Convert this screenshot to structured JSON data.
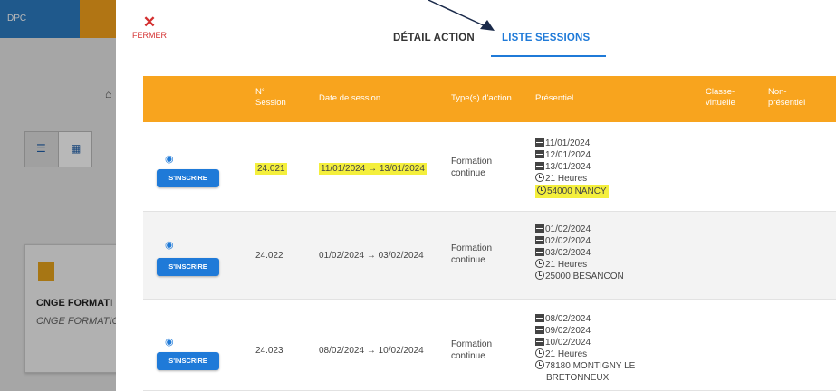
{
  "background": {
    "topbar_label": "DPC",
    "card_title": "CNGE FORMATI",
    "card_subtitle": "CNGE FORMATIO"
  },
  "modal": {
    "close_label": "FERMER",
    "tabs": [
      {
        "label": "DÉTAIL ACTION",
        "active": false
      },
      {
        "label": "LISTE SESSIONS",
        "active": true
      }
    ]
  },
  "table": {
    "headers": {
      "num": [
        "N°",
        "Session"
      ],
      "date": "Date de session",
      "type": "Type(s) d'action",
      "presentiel": "Présentiel",
      "classe": [
        "Classe-",
        "virtuelle"
      ],
      "non": [
        "Non-",
        "présentiel"
      ]
    },
    "button_label": "S'INSCRIRE",
    "rows": [
      {
        "num": "24.021",
        "dates": "11/01/2024 → 13/01/2024",
        "type": [
          "Formation",
          "continue"
        ],
        "presentiel_dates": [
          "11/01/2024",
          "12/01/2024",
          "13/01/2024"
        ],
        "hours": "21 Heures",
        "location": [
          "54000 NANCY"
        ],
        "highlighted": true
      },
      {
        "num": "24.022",
        "dates": "01/02/2024 → 03/02/2024",
        "type": [
          "Formation",
          "continue"
        ],
        "presentiel_dates": [
          "01/02/2024",
          "02/02/2024",
          "03/02/2024"
        ],
        "hours": "21 Heures",
        "location": [
          "25000 BESANCON"
        ],
        "highlighted": false
      },
      {
        "num": "24.023",
        "dates": "08/02/2024 → 10/02/2024",
        "type": [
          "Formation",
          "continue"
        ],
        "presentiel_dates": [
          "08/02/2024",
          "09/02/2024",
          "10/02/2024"
        ],
        "hours": "21 Heures",
        "location": [
          "78180 MONTIGNY LE",
          "BRETONNEUX"
        ],
        "highlighted": false
      }
    ]
  },
  "colors": {
    "header_orange": "#f8a41e",
    "accent_blue": "#1f7ad8",
    "close_red": "#d32f2f",
    "highlight_yellow": "#f4ef3c"
  }
}
